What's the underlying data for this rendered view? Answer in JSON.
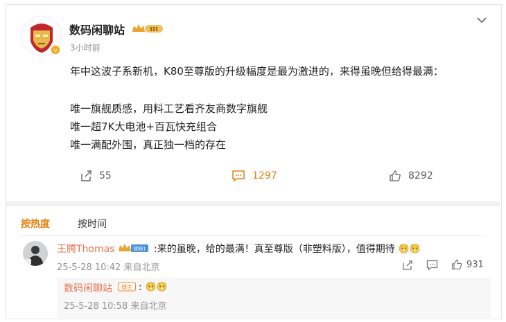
{
  "post": {
    "author": "数码闲聊站",
    "badge_level": "III",
    "time": "3小时前",
    "lines": [
      "年中这波子系新机，K80至尊版的升级幅度是最为激进的，来得虽晚但给得最满：",
      "唯一旗舰质感，用料工艺看齐友商数字旗舰",
      "唯一超7K大电池+百瓦快充组合",
      "唯一满配外围，真正独一档的存在"
    ],
    "actions": {
      "repost": "55",
      "comments": "1297",
      "likes": "8292"
    }
  },
  "sort_tabs": {
    "hot": "按热度",
    "time": "按时间"
  },
  "comment": {
    "name": "王腾Thomas",
    "badge_label": "铁粉1",
    "text": ":来的虽晚，给的最满！真至尊版（非塑料版），值得期待",
    "meta": "25-5-28 10:42 来自北京",
    "likes": "931"
  },
  "reply": {
    "name": "数码闲聊站",
    "badge_label": "博主",
    "text": ":",
    "meta": "25-5-28 10:58 来自北京"
  },
  "colors": {
    "accent_orange": "#e87f0e",
    "name_color": "#eb7350",
    "gold": "#e8a532"
  }
}
